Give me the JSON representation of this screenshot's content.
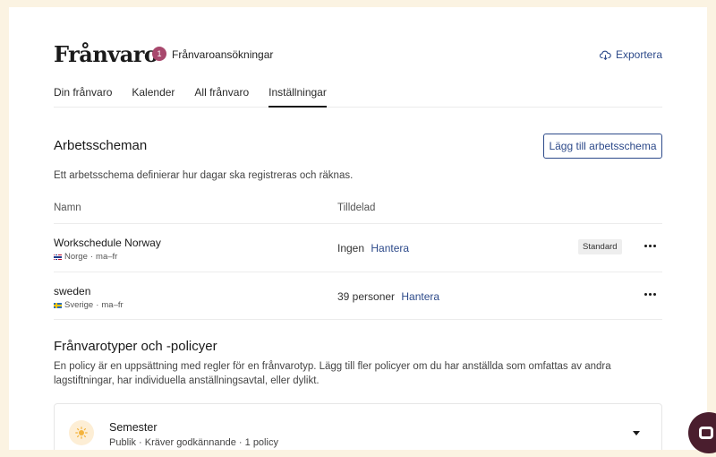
{
  "header": {
    "title": "Frånvaro",
    "request_count": "1",
    "requests_label": "Frånvaroansökningar",
    "export_label": "Exportera",
    "export_icon": "cloud-download-icon"
  },
  "tabs": [
    {
      "label": "Din frånvaro",
      "active": false
    },
    {
      "label": "Kalender",
      "active": false
    },
    {
      "label": "All frånvaro",
      "active": false
    },
    {
      "label": "Inställningar",
      "active": true
    }
  ],
  "work_schedules": {
    "title": "Arbetsscheman",
    "add_button": "Lägg till arbetsschema",
    "description": "Ett arbetsschema definierar hur dagar ska registreras och räknas.",
    "columns": {
      "name": "Namn",
      "assigned": "Tilldelad"
    },
    "rows": [
      {
        "name": "Workschedule Norway",
        "country": "Norge",
        "days": "ma–fr",
        "flag": "norway-flag",
        "assigned": "Ingen",
        "manage": "Hantera",
        "badge": "Standard"
      },
      {
        "name": "sweden",
        "country": "Sverige",
        "days": "ma–fr",
        "flag": "sweden-flag",
        "assigned": "39 personer",
        "manage": "Hantera",
        "badge": ""
      }
    ]
  },
  "policies": {
    "title": "Frånvarotyper och -policyer",
    "description": "En policy är en uppsättning med regler för en frånvarotyp. Lägg till fler policyer om du har anställda som omfattas av andra lagstiftningar, har individuella anställningsavtal, eller dylikt.",
    "items": [
      {
        "name": "Semester",
        "meta": "Publik · Kräver godkännande · 1 policy",
        "icon": "sun-icon"
      }
    ]
  },
  "colors": {
    "page_background": "#fbf3e2",
    "accent": "#2d4a8a",
    "badge": "#a8486d",
    "chat_button": "#4a1e2e"
  }
}
